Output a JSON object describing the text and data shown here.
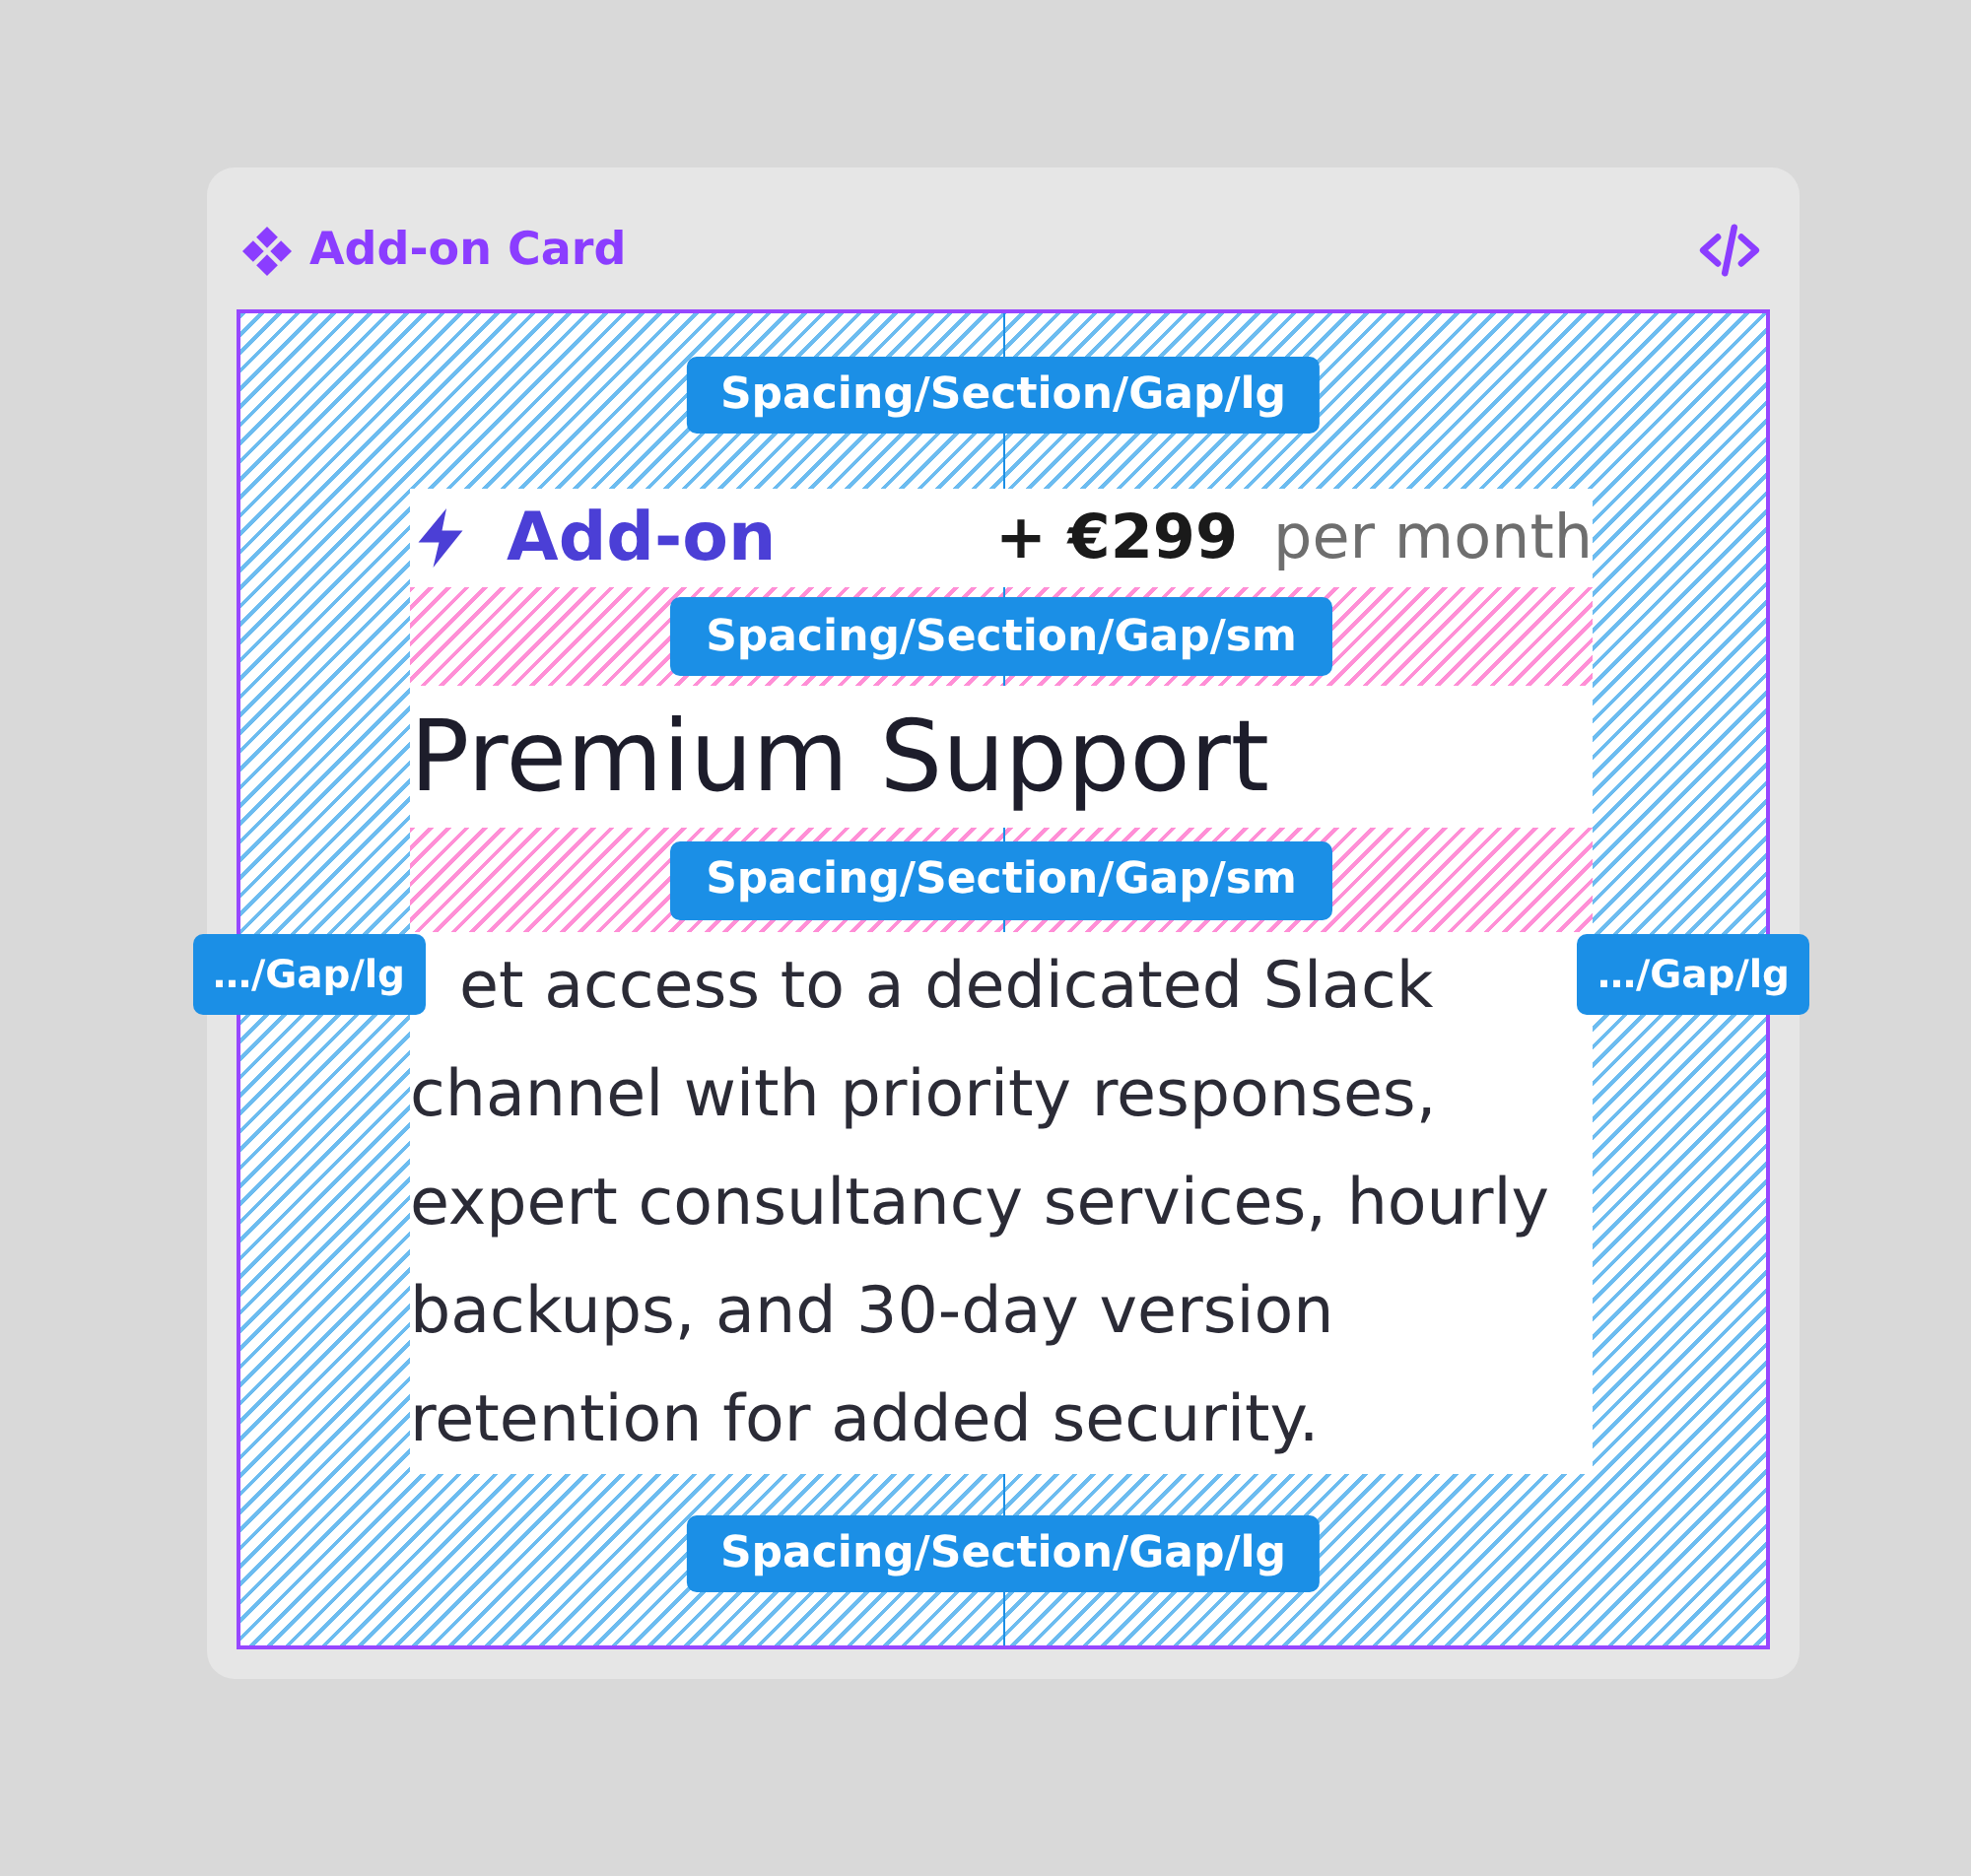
{
  "component": {
    "title": "Add-on Card"
  },
  "spacing": {
    "top": "Spacing/Section/Gap/lg",
    "left": "…/Gap/lg",
    "right": "…/Gap/lg",
    "bottom": "Spacing/Section/Gap/lg"
  },
  "card": {
    "tag": "Add-on",
    "price": "+ €299",
    "period": "per month",
    "gaps": [
      "Spacing/Section/Gap/sm",
      "Spacing/Section/Gap/sm"
    ],
    "title": "Premium Support",
    "description": "et access to a dedicated Slack channel with priority responses, expert consultancy services, hourly backups, and 30-day version retention for added security."
  }
}
